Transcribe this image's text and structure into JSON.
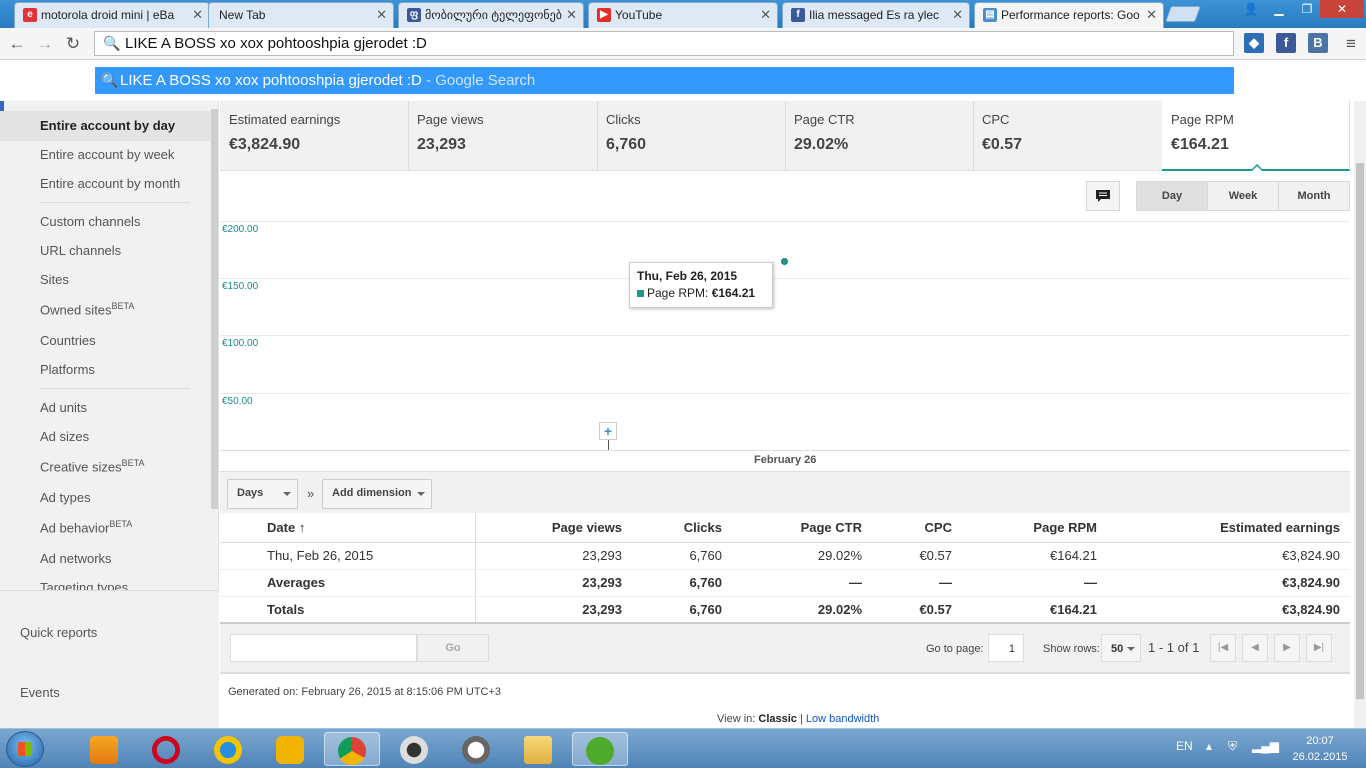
{
  "browser": {
    "tabs": [
      {
        "title": "motorola droid mini | eBa",
        "favicon": "ebay-icon"
      },
      {
        "title": "New Tab",
        "favicon": "blank"
      },
      {
        "title": "მობილური ტელეფონებ",
        "favicon": "site-icon"
      },
      {
        "title": "YouTube",
        "favicon": "youtube-icon"
      },
      {
        "title": "Ilia messaged Es ra ylec",
        "favicon": "facebook-icon"
      },
      {
        "title": "Performance reports: Goo",
        "favicon": "adsense-icon"
      }
    ],
    "omnibox_text": "LIKE A BOSS  xo xox pohtooshpia gjerodet :D",
    "suggestion_query": "LIKE A BOSS xo xox pohtooshpia gjerodet :D",
    "suggestion_suffix": " - Google Search"
  },
  "sidebar": {
    "items": [
      {
        "label": "Entire account by day",
        "selected": true
      },
      {
        "label": "Entire account by week"
      },
      {
        "label": "Entire account by month"
      },
      {
        "label": "Custom channels"
      },
      {
        "label": "URL channels"
      },
      {
        "label": "Sites"
      },
      {
        "label": "Owned sites",
        "badge": "BETA"
      },
      {
        "label": "Countries"
      },
      {
        "label": "Platforms"
      },
      {
        "label": "Ad units"
      },
      {
        "label": "Ad sizes"
      },
      {
        "label": "Creative sizes",
        "badge": "BETA"
      },
      {
        "label": "Ad types"
      },
      {
        "label": "Ad behavior",
        "badge": "BETA"
      },
      {
        "label": "Ad networks"
      },
      {
        "label": "Targeting types"
      }
    ],
    "quick_reports": "Quick reports",
    "events": "Events"
  },
  "metrics": [
    {
      "label": "Estimated earnings",
      "value": "€3,824.90"
    },
    {
      "label": "Page views",
      "value": "23,293"
    },
    {
      "label": "Clicks",
      "value": "6,760"
    },
    {
      "label": "Page CTR",
      "value": "29.02%"
    },
    {
      "label": "CPC",
      "value": "€0.57"
    },
    {
      "label": "Page RPM",
      "value": "€164.21",
      "active": true
    }
  ],
  "granularity": {
    "day": "Day",
    "week": "Week",
    "month": "Month",
    "selected": "Day"
  },
  "chart_data": {
    "type": "scatter",
    "x": [
      "2015-02-26"
    ],
    "series": [
      {
        "name": "Page RPM",
        "values": [
          164.21
        ]
      }
    ],
    "yticks": [
      "€200.00",
      "€150.00",
      "€100.00",
      "€50.00"
    ],
    "ylim": [
      0,
      200
    ],
    "xlabel": "February 26",
    "tooltip": {
      "title": "Thu, Feb 26, 2015",
      "label": "Page RPM:",
      "value": "€164.21"
    },
    "color": "#1b998b"
  },
  "dimensions": {
    "days": "Days",
    "separator": "»",
    "add": "Add dimension"
  },
  "table": {
    "headers": [
      "Date",
      "Page views",
      "Clicks",
      "Page CTR",
      "CPC",
      "Page RPM",
      "Estimated earnings"
    ],
    "sort_indicator": "↑",
    "rows": [
      [
        "Thu, Feb 26, 2015",
        "23,293",
        "6,760",
        "29.02%",
        "€0.57",
        "€164.21",
        "€3,824.90"
      ],
      [
        "Averages",
        "23,293",
        "6,760",
        "—",
        "—",
        "—",
        "€3,824.90"
      ],
      [
        "Totals",
        "23,293",
        "6,760",
        "29.02%",
        "€0.57",
        "€164.21",
        "€3,824.90"
      ]
    ]
  },
  "pager": {
    "go": "Go",
    "goto_label": "Go to page:",
    "page": "1",
    "show_rows_label": "Show rows:",
    "rows": "50",
    "range": "1 - 1 of 1"
  },
  "footer": {
    "generated": "Generated on: February 26, 2015 at 8:15:06 PM UTC+3",
    "view_in": "View in:",
    "classic": "Classic",
    "separator": "|",
    "low_bandwidth": "Low bandwidth"
  },
  "taskbar": {
    "lang": "EN",
    "time": "20:07",
    "date": "26.02.2015"
  }
}
